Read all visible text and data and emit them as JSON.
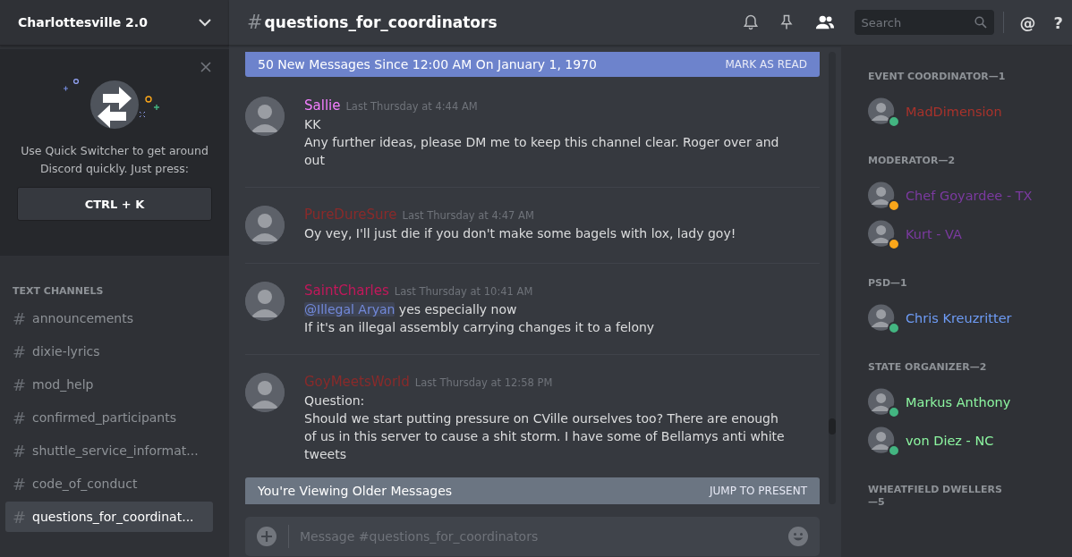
{
  "server": {
    "name": "Charlottesville 2.0"
  },
  "quick_switcher": {
    "text": "Use Quick Switcher to get around Discord quickly. Just press:",
    "shortcut": "CTRL + K"
  },
  "channel_category": "TEXT CHANNELS",
  "channels": [
    {
      "hash": "#",
      "name": "announcements",
      "selected": false
    },
    {
      "hash": "#",
      "name": "dixie-lyrics",
      "selected": false
    },
    {
      "hash": "#",
      "name": "mod_help",
      "selected": false
    },
    {
      "hash": "#",
      "name": "confirmed_participants",
      "selected": false
    },
    {
      "hash": "#",
      "name": "shuttle_service_informat...",
      "selected": false
    },
    {
      "hash": "#",
      "name": "code_of_conduct",
      "selected": false
    },
    {
      "hash": "#",
      "name": "questions_for_coordinat...",
      "selected": true
    }
  ],
  "header": {
    "hash": "#",
    "channel": "questions_for_coordinators",
    "search_placeholder": "Search",
    "mention": "@",
    "help": "?"
  },
  "new_messages_bar": {
    "text": "50 New Messages Since 12:00 AM On January 1, 1970",
    "action": "MARK AS READ"
  },
  "messages": [
    {
      "author": "Sallie",
      "color": "#f47fff",
      "time": "Last Thursday at 4:44 AM",
      "lines": [
        "KK",
        "Any further ideas, please DM me to keep this channel clear.  Roger over and out"
      ]
    },
    {
      "author": "PureDureSure",
      "color": "#8a2a2a",
      "time": "Last Thursday at 4:47 AM",
      "lines": [
        "Oy vey, I'll just die if you don't make some bagels with lox, lady goy!"
      ]
    },
    {
      "author": "SaintCharles",
      "color": "#c2185b",
      "time": "Last Thursday at 10:41 AM",
      "mention": "@Illegal Aryan",
      "lines": [
        "yes especially now",
        "If it's an illegal assembly carrying changes it to a felony"
      ]
    },
    {
      "author": "GoyMeetsWorld",
      "color": "#8a2a2a",
      "time": "Last Thursday at 12:58 PM",
      "lines": [
        "Question:",
        "Should we start putting pressure on CVille ourselves too? There are enough of us in this server to cause a shit storm. I have some of Bellamys anti white tweets"
      ]
    }
  ],
  "older_messages_bar": {
    "text": "You're Viewing Older Messages",
    "action": "JUMP TO PRESENT"
  },
  "composer": {
    "placeholder": "Message #questions_for_coordinators"
  },
  "member_groups": [
    {
      "title": "EVENT COORDINATOR—1",
      "members": [
        {
          "name": "MadDimension",
          "color": "#a8322b",
          "status_dot": {
            "color": "#43b581"
          }
        }
      ]
    },
    {
      "title": "MODERATOR—2",
      "members": [
        {
          "name": "Chef Goyardee - TX",
          "color": "#7b3aa0",
          "status_dot": {
            "color": "#faa61a"
          }
        },
        {
          "name": "Kurt - VA",
          "color": "#7b3aa0",
          "status_dot": {
            "color": "#faa61a"
          }
        }
      ]
    },
    {
      "title": "PSD—1",
      "members": [
        {
          "name": "Chris Kreuzritter",
          "color": "#6e9cf6",
          "status_dot": {
            "color": "#43b581"
          }
        }
      ]
    },
    {
      "title": "STATE ORGANIZER—2",
      "members": [
        {
          "name": "Markus Anthony",
          "color": "#8cf5a0",
          "status_dot": {
            "color": "#43b581"
          }
        },
        {
          "name": "von Diez - NC",
          "color": "#8cf5a0",
          "status_dot": {
            "color": "#43b581"
          }
        }
      ]
    },
    {
      "title": "WHEATFIELD DWELLERS—5"
    }
  ]
}
